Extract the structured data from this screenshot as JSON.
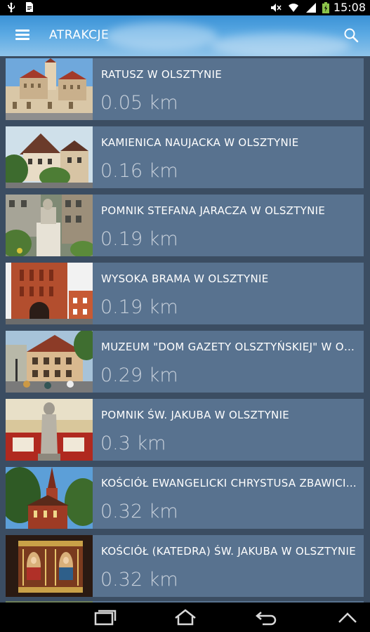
{
  "status_bar": {
    "time": "15:08",
    "icons": [
      "usb-icon",
      "document-icon",
      "mute-icon",
      "wifi-icon",
      "signal-icon",
      "battery-icon"
    ]
  },
  "toolbar": {
    "title": "ATRAKCJE",
    "menu_icon": "hamburger-menu-icon",
    "search_icon": "search-icon",
    "colors": {
      "top": "#3b92d6",
      "bottom": "#8ec3ea"
    }
  },
  "attractions": [
    {
      "name": "RATUSZ W OLSZTYNIE",
      "distance": "0.05 km"
    },
    {
      "name": "KAMIENICA NAUJACKA W OLSZTYNIE",
      "distance": "0.16 km"
    },
    {
      "name": "POMNIK STEFANA JARACZA W OLSZTYNIE",
      "distance": "0.19 km"
    },
    {
      "name": "WYSOKA BRAMA W OLSZTYNIE",
      "distance": "0.19 km"
    },
    {
      "name": "MUZEUM \"DOM GAZETY OLSZTYŃSKIEJ\" W OLSZTYNIE",
      "distance": "0.29 km"
    },
    {
      "name": "POMNIK ŚW. JAKUBA W OLSZTYNIE",
      "distance": "0.3 km"
    },
    {
      "name": "KOŚCIÓŁ EWANGELICKI CHRYSTUSA ZBAWICIELA W OLSZTYNIE",
      "distance": "0.32 km"
    },
    {
      "name": "KOŚCIÓŁ (KATEDRA) ŚW. JAKUBA W OLSZTYNIE",
      "distance": "0.32 km"
    }
  ],
  "nav_bar": {
    "icons": [
      "recent-apps-icon",
      "home-icon",
      "back-icon",
      "menu-up-icon"
    ]
  },
  "colors": {
    "item_background": "#58728f",
    "list_background": "#3b4d62",
    "distance_text": "#c8d1dc"
  }
}
